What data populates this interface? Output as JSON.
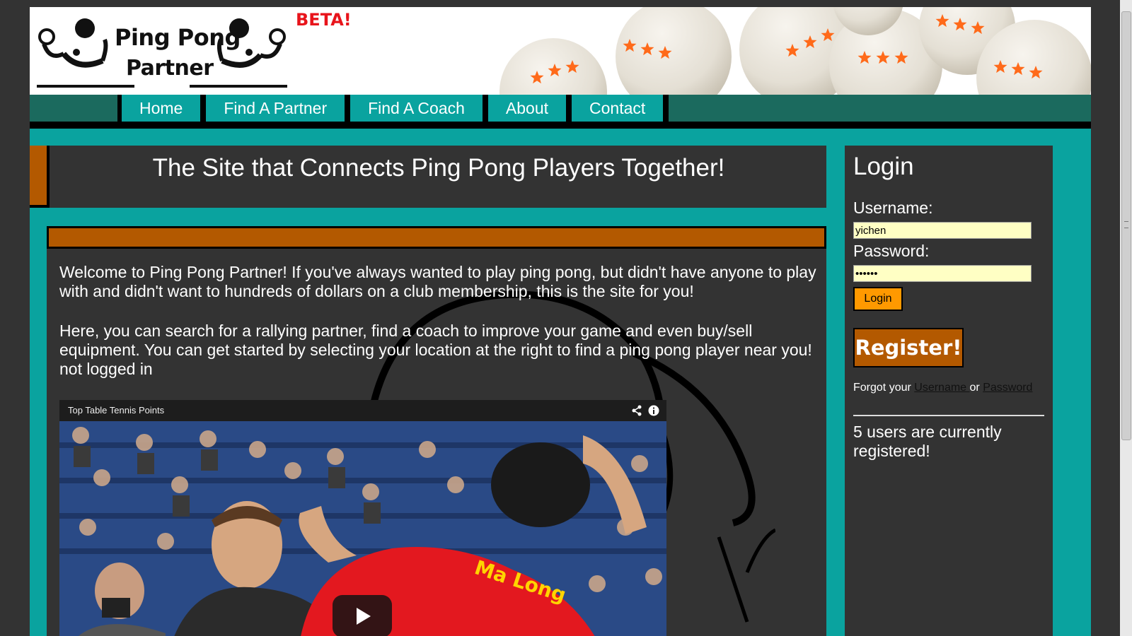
{
  "header": {
    "logo_line1": "Ping Pong",
    "logo_line2": "Partner",
    "beta_label": "BETA!"
  },
  "nav": {
    "items": [
      {
        "label": "Home"
      },
      {
        "label": "Find A Partner"
      },
      {
        "label": "Find A Coach"
      },
      {
        "label": "About"
      },
      {
        "label": "Contact"
      }
    ]
  },
  "main": {
    "title": "The Site that Connects Ping Pong Players Together!",
    "paragraph1": "Welcome to Ping Pong Partner! If you've always wanted to play ping pong, but didn't have anyone to play with and didn't want to hundreds of dollars on a club membership, this is the site for you!",
    "paragraph2": "Here, you can search for a rallying partner, find a coach to improve your game and even buy/sell equipment. You can get started by selecting your location at the right to find a ping pong player near you! not logged in",
    "video": {
      "title": "Top Table Tennis Points",
      "jersey_text": "Ma Long"
    }
  },
  "sidebar": {
    "login_heading": "Login",
    "username_label": "Username:",
    "username_value": "yichen",
    "password_label": "Password:",
    "password_value": "passwd",
    "login_button": "Login",
    "register_button": "Register!",
    "forgot_prefix": "Forgot your ",
    "forgot_username": "Username ",
    "forgot_or": "or ",
    "forgot_password": "Password",
    "users_count_text": "5 users are currently registered!"
  },
  "colors": {
    "page_bg": "#333333",
    "teal": "#0aa39f",
    "nav_dark": "#1b6a5e",
    "orange_accent": "#b35900",
    "login_orange": "#ff9900",
    "beta_red": "#e8141b",
    "input_bg": "#ffffc4"
  },
  "icons": [
    "share-icon",
    "info-icon",
    "play-icon",
    "star-icon"
  ]
}
